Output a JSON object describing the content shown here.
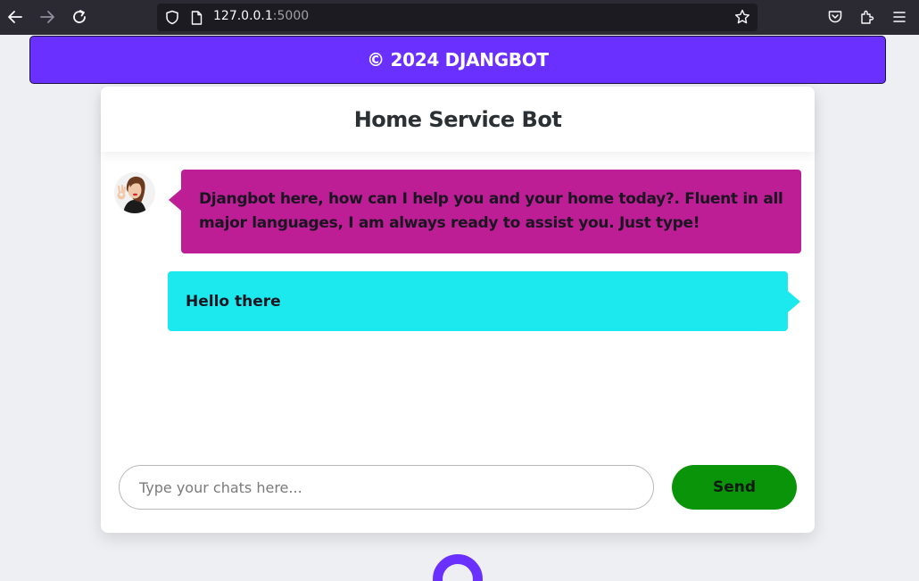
{
  "browser": {
    "url_host": "127.0.0.1",
    "url_port": ":5000"
  },
  "banner": {
    "text": "© 2024 DJANGBOT"
  },
  "chat": {
    "title": "Home Service Bot",
    "messages": [
      {
        "sender": "bot",
        "text": "Djangbot here, how can I help you and your home today?. Fluent in all major languages, I am always ready to assist you. Just type!"
      },
      {
        "sender": "user",
        "text": "Hello there"
      }
    ],
    "input_placeholder": "Type your chats here...",
    "input_value": "",
    "send_label": "Send"
  },
  "colors": {
    "banner_bg": "#6a30ff",
    "bot_bubble": "#bd1e96",
    "user_bubble": "#1be9ee",
    "send_button": "#0a9409",
    "loader": "#6a30ff"
  },
  "icons": {
    "back": "arrow-left-icon",
    "forward": "arrow-right-icon",
    "reload": "reload-icon",
    "shield": "shield-icon",
    "page": "page-icon",
    "bookmark": "star-icon",
    "pocket": "pocket-icon",
    "extensions": "puzzle-icon",
    "menu": "hamburger-menu-icon"
  }
}
